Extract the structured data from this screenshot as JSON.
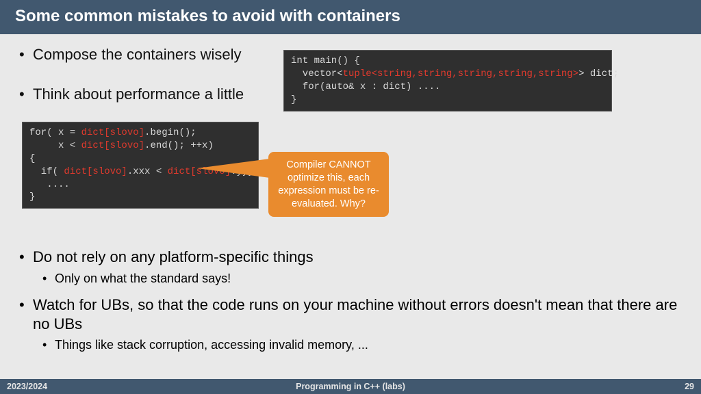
{
  "title": "Some common mistakes to avoid with containers",
  "bullets": {
    "b1": "Compose the containers wisely",
    "b2": "Think about performance a little",
    "b3": "Do not rely on any platform-specific things",
    "b3_sub": "Only on what the standard says!",
    "b4": "Watch for UBs, so that the code runs on your machine without errors doesn't mean that there are no UBs",
    "b4_sub": "Things like stack corruption, accessing invalid memory, ..."
  },
  "code1": {
    "l1a": "int main() {",
    "l2a": "  vector<",
    "l2b": "tuple<string,string,string,string,string>",
    "l2c": "> dict;",
    "l3a": "  for(auto& x : dict) ....",
    "l4a": "}"
  },
  "code2": {
    "l1a": "for( x = ",
    "l1b": "dict[slovo]",
    "l1c": ".begin();",
    "l2a": "     x < ",
    "l2b": "dict[slovo]",
    "l2c": ".end(); ++x)",
    "l3a": "{",
    "l4a": "  if( ",
    "l4b": "dict[slovo]",
    "l4c": ".xxx < ",
    "l4d": "dict[slovo]",
    "l4e": ".yyy)",
    "l5a": "   ....",
    "l6a": "}"
  },
  "callout": "Compiler CANNOT optimize this, each expression must be re-evaluated. Why?",
  "footer": {
    "left": "2023/2024",
    "center": "Programming in C++ (labs)",
    "right": "29"
  }
}
